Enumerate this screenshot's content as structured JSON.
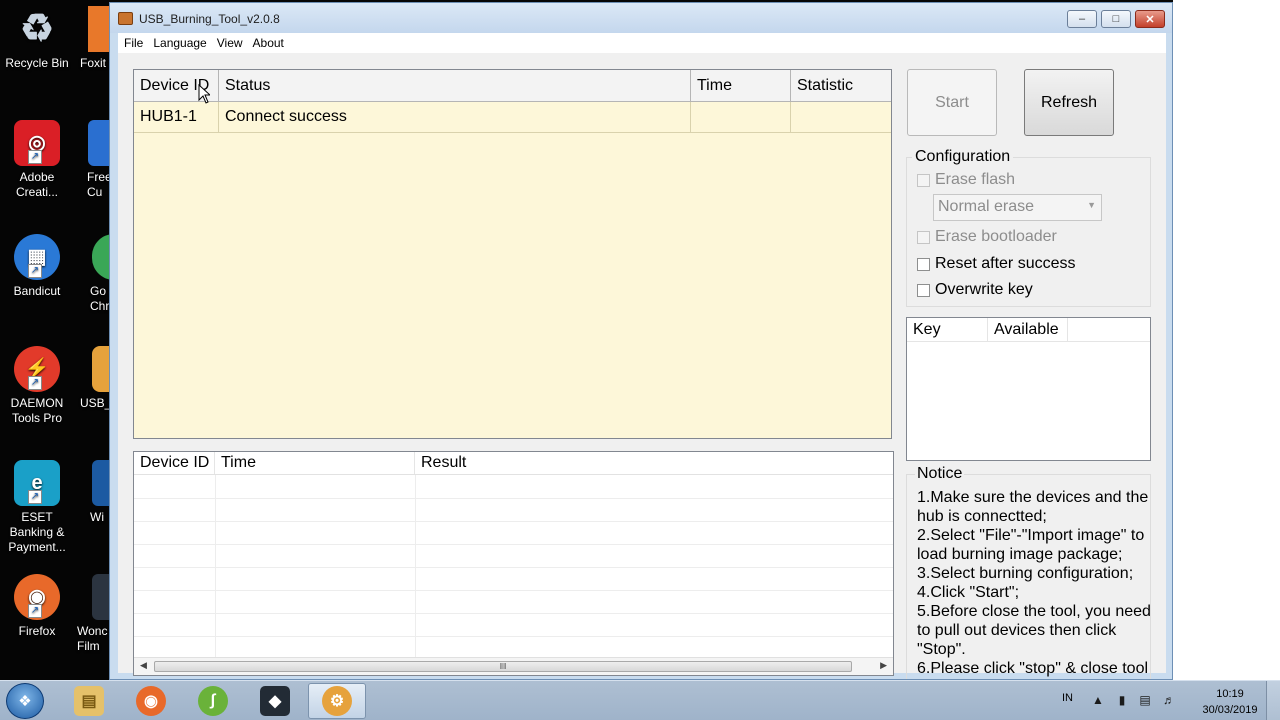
{
  "desktop": {
    "icons": [
      {
        "label": "Recycle Bin",
        "glyph": "♲",
        "color": "#8a9bab"
      },
      {
        "label": "Adobe Creati...",
        "glyph": "◎",
        "color": "#da1f26"
      },
      {
        "label": "Bandicut",
        "glyph": "▦",
        "color": "#2a79d6"
      },
      {
        "label": "DAEMON Tools Pro",
        "glyph": "⚡",
        "color": "#e23a2a"
      },
      {
        "label": "ESET Banking & Payment...",
        "glyph": "e",
        "color": "#1aa0c8"
      },
      {
        "label": "Firefox",
        "glyph": "◉",
        "color": "#e8692a"
      }
    ],
    "partial_icons": [
      "Foxit",
      "Free Cu",
      "Go Chr",
      "USB_",
      "Wi",
      "Wonc Film"
    ]
  },
  "window": {
    "title": "USB_Burning_Tool_v2.0.8",
    "controls": {
      "minimize": "–",
      "maximize": "□",
      "close": "✕"
    }
  },
  "menu": [
    "File",
    "Language",
    "View",
    "About"
  ],
  "device_table": {
    "headers": [
      "Device ID",
      "Status",
      "Time",
      "Statistic"
    ],
    "rows": [
      [
        "HUB1-1",
        "Connect success",
        "",
        ""
      ]
    ]
  },
  "result_table": {
    "headers": [
      "Device ID",
      "Time",
      "Result"
    ]
  },
  "buttons": {
    "start": "Start",
    "refresh": "Refresh"
  },
  "configuration": {
    "title": "Configuration",
    "erase_flash": "Erase flash",
    "erase_mode": "Normal erase",
    "erase_bootloader": "Erase bootloader",
    "reset_after_success": "Reset after success",
    "overwrite_key": "Overwrite key"
  },
  "key_table": {
    "headers": [
      "Key",
      "Available"
    ]
  },
  "notice": {
    "title": "Notice",
    "text": "1.Make sure the devices and the hub is connectted;\n2.Select \"File\"-\"Import image\" to load burning image package;\n3.Select burning configuration;\n4.Click \"Start\";\n5.Before close the tool, you need to pull out devices then click \"Stop\".\n6.Please click \"stop\" & close tool"
  },
  "taskbar": {
    "language": "IN",
    "time": "10:19",
    "date": "30/03/2019"
  }
}
